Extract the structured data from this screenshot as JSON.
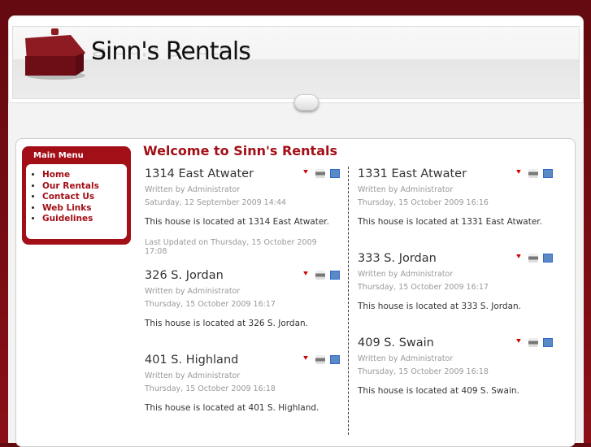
{
  "site": {
    "logo_text": "Sinn's Rentals"
  },
  "menu": {
    "title": "Main Menu",
    "items": [
      "Home",
      "Our Rentals",
      "Contact Us",
      "Web Links",
      "Guidelines"
    ]
  },
  "page_title": "Welcome to Sinn's Rentals",
  "articles": [
    {
      "title": "1314 East Atwater",
      "author": "Written by Administrator",
      "date": "Saturday, 12 September 2009 14:44",
      "body": "This house is located at 1314 East Atwater.",
      "updated": "Last Updated on Thursday, 15 October 2009 17:08"
    },
    {
      "title": "326 S. Jordan",
      "author": "Written by Administrator",
      "date": "Thursday, 15 October 2009 16:17",
      "body": "This house is located at 326 S. Jordan."
    },
    {
      "title": "401 S. Highland",
      "author": "Written by Administrator",
      "date": "Thursday, 15 October 2009 16:18",
      "body": "This house is located at 401 S. Highland."
    },
    {
      "title": "1331 East Atwater",
      "author": "Written by Administrator",
      "date": "Thursday, 15 October 2009 16:16",
      "body": "This house is located at 1331 East Atwater."
    },
    {
      "title": "333 S. Jordan",
      "author": "Written by Administrator",
      "date": "Thursday, 15 October 2009 16:17",
      "body": "This house is located at 333 S. Jordan."
    },
    {
      "title": "409 S. Swain",
      "author": "Written by Administrator",
      "date": "Thursday, 15 October 2009 16:18",
      "body": "This house is located at 409 S. Swain."
    }
  ]
}
